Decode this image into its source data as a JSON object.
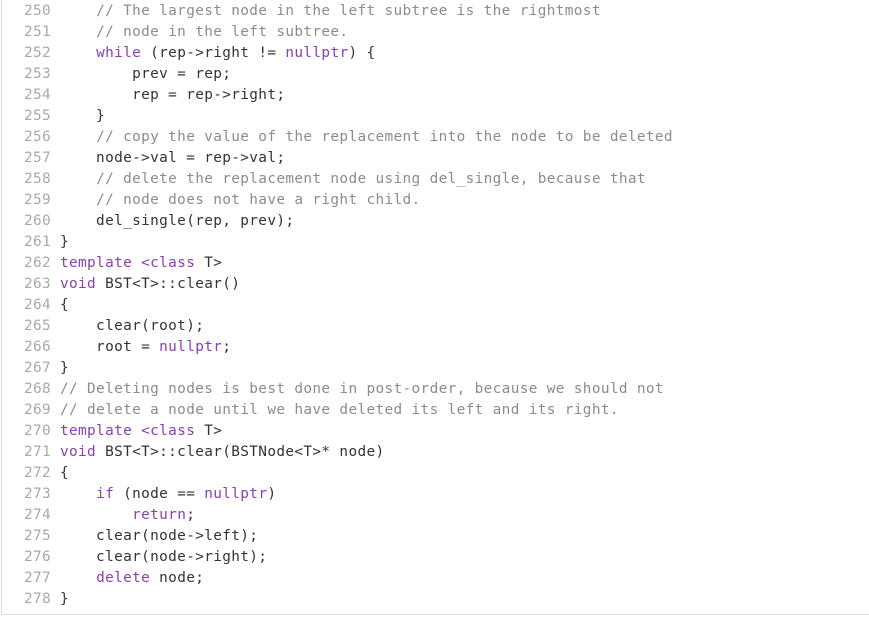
{
  "editor": {
    "colors": {
      "keyword": "#8b3fb0",
      "comment": "#8c8c8c",
      "text": "#333333",
      "line_number": "#a9a9a9",
      "border": "#dddddd"
    },
    "lines": [
      {
        "n": "250",
        "tokens": [
          {
            "t": "    "
          },
          {
            "t": "// The largest node in the left subtree is the rightmost",
            "c": "cm"
          }
        ]
      },
      {
        "n": "251",
        "tokens": [
          {
            "t": "    "
          },
          {
            "t": "// node in the left subtree.",
            "c": "cm"
          }
        ]
      },
      {
        "n": "252",
        "tokens": [
          {
            "t": "    "
          },
          {
            "t": "while",
            "c": "kw"
          },
          {
            "t": " (rep->right != "
          },
          {
            "t": "nullptr",
            "c": "kw"
          },
          {
            "t": ") {"
          }
        ]
      },
      {
        "n": "253",
        "tokens": [
          {
            "t": "        prev = rep;"
          }
        ]
      },
      {
        "n": "254",
        "tokens": [
          {
            "t": "        rep = rep->right;"
          }
        ]
      },
      {
        "n": "255",
        "tokens": [
          {
            "t": "    }"
          }
        ]
      },
      {
        "n": "256",
        "tokens": [
          {
            "t": "    "
          },
          {
            "t": "// copy the value of the replacement into the node to be deleted",
            "c": "cm"
          }
        ]
      },
      {
        "n": "257",
        "tokens": [
          {
            "t": "    node->val = rep->val;"
          }
        ]
      },
      {
        "n": "258",
        "tokens": [
          {
            "t": "    "
          },
          {
            "t": "// delete the replacement node using del_single, because that",
            "c": "cm"
          }
        ]
      },
      {
        "n": "259",
        "tokens": [
          {
            "t": "    "
          },
          {
            "t": "// node does not have a right child.",
            "c": "cm"
          }
        ]
      },
      {
        "n": "260",
        "tokens": [
          {
            "t": "    del_single(rep, prev);"
          }
        ]
      },
      {
        "n": "261",
        "tokens": [
          {
            "t": "}"
          }
        ]
      },
      {
        "n": "262",
        "tokens": [
          {
            "t": "template",
            "c": "kw"
          },
          {
            "t": " "
          },
          {
            "t": "<class",
            "c": "kw"
          },
          {
            "t": " T>"
          }
        ]
      },
      {
        "n": "263",
        "tokens": [
          {
            "t": "void",
            "c": "kw"
          },
          {
            "t": " BST<T>::clear()"
          }
        ]
      },
      {
        "n": "264",
        "tokens": [
          {
            "t": "{"
          }
        ]
      },
      {
        "n": "265",
        "tokens": [
          {
            "t": "    clear(root);"
          }
        ]
      },
      {
        "n": "266",
        "tokens": [
          {
            "t": "    root = "
          },
          {
            "t": "nullptr",
            "c": "kw"
          },
          {
            "t": ";"
          }
        ]
      },
      {
        "n": "267",
        "tokens": [
          {
            "t": "}"
          }
        ]
      },
      {
        "n": "268",
        "tokens": [
          {
            "t": "// Deleting nodes is best done in post-order, because we should not",
            "c": "cm"
          }
        ]
      },
      {
        "n": "269",
        "tokens": [
          {
            "t": "// delete a node until we have deleted its left and its right.",
            "c": "cm"
          }
        ]
      },
      {
        "n": "270",
        "tokens": [
          {
            "t": "template",
            "c": "kw"
          },
          {
            "t": " "
          },
          {
            "t": "<class",
            "c": "kw"
          },
          {
            "t": " T>"
          }
        ]
      },
      {
        "n": "271",
        "tokens": [
          {
            "t": "void",
            "c": "kw"
          },
          {
            "t": " BST<T>::clear(BSTNode<T>* node)"
          }
        ]
      },
      {
        "n": "272",
        "tokens": [
          {
            "t": "{"
          }
        ]
      },
      {
        "n": "273",
        "tokens": [
          {
            "t": "    "
          },
          {
            "t": "if",
            "c": "kw"
          },
          {
            "t": " (node == "
          },
          {
            "t": "nullptr",
            "c": "kw"
          },
          {
            "t": ")"
          }
        ]
      },
      {
        "n": "274",
        "tokens": [
          {
            "t": "        "
          },
          {
            "t": "return",
            "c": "kw"
          },
          {
            "t": ";"
          }
        ]
      },
      {
        "n": "275",
        "tokens": [
          {
            "t": "    clear(node->left);"
          }
        ]
      },
      {
        "n": "276",
        "tokens": [
          {
            "t": "    clear(node->right);"
          }
        ]
      },
      {
        "n": "277",
        "tokens": [
          {
            "t": "    "
          },
          {
            "t": "delete",
            "c": "kw"
          },
          {
            "t": " node;"
          }
        ]
      },
      {
        "n": "278",
        "tokens": [
          {
            "t": "}"
          }
        ]
      }
    ]
  }
}
